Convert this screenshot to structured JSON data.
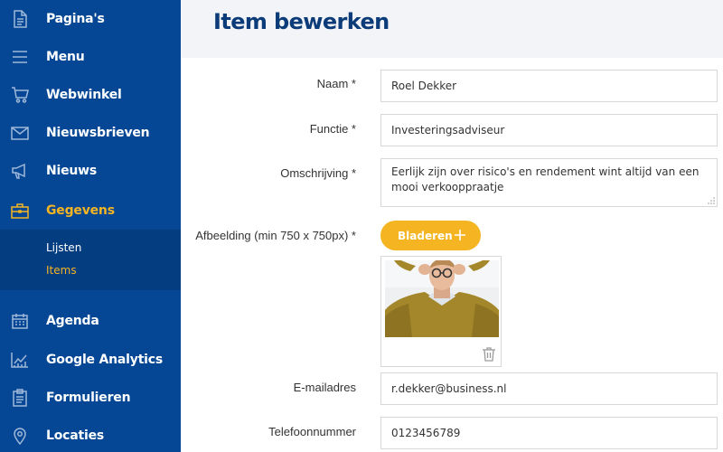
{
  "sidebar": {
    "items": [
      {
        "label": "Pagina's",
        "icon": "document-icon"
      },
      {
        "label": "Menu",
        "icon": "menu-icon"
      },
      {
        "label": "Webwinkel",
        "icon": "cart-icon"
      },
      {
        "label": "Nieuwsbrieven",
        "icon": "envelope-icon"
      },
      {
        "label": "Nieuws",
        "icon": "megaphone-icon"
      },
      {
        "label": "Gegevens",
        "icon": "briefcase-icon",
        "active": true
      },
      {
        "label": "Agenda",
        "icon": "calendar-icon"
      },
      {
        "label": "Google Analytics",
        "icon": "chart-icon"
      },
      {
        "label": "Formulieren",
        "icon": "clipboard-icon"
      },
      {
        "label": "Locaties",
        "icon": "location-pin-icon"
      }
    ],
    "submenu": [
      {
        "label": "Lijsten"
      },
      {
        "label": "Items",
        "active": true
      }
    ]
  },
  "header": {
    "title": "Item bewerken"
  },
  "form": {
    "name": {
      "label": "Naam *",
      "value": "Roel Dekker"
    },
    "function": {
      "label": "Functie *",
      "value": "Investeringsadviseur"
    },
    "description": {
      "label": "Omschrijving *",
      "value": "Eerlijk zijn over risico's en rendement wint altijd van een mooi verkooppraatje"
    },
    "image": {
      "label": "Afbeelding (min 750 x 750px) *",
      "browse_label": "Bladeren"
    },
    "email": {
      "label": "E-mailadres",
      "value": "r.dekker@business.nl"
    },
    "phone": {
      "label": "Telefoonnummer",
      "value": "0123456789"
    }
  },
  "colors": {
    "sidebar_bg": "#054794",
    "accent": "#f5b522",
    "title": "#0b3b78"
  }
}
